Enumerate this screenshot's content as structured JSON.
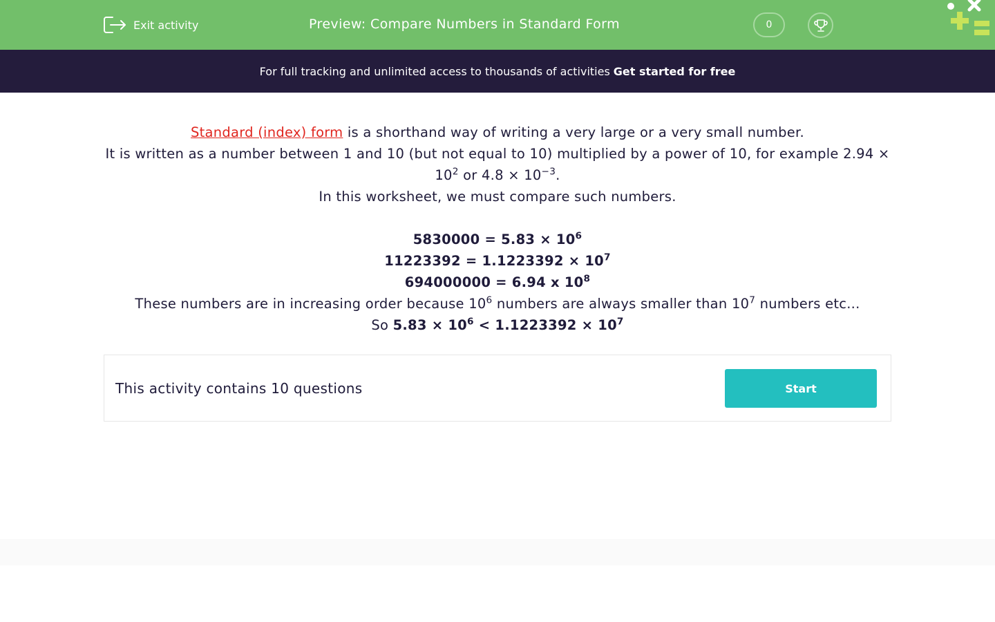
{
  "header": {
    "exit_label": "Exit activity",
    "title": "Preview: Compare Numbers in Standard Form",
    "score": "0",
    "background_color": "#72bf6a",
    "icons": [
      "exit-icon",
      "trophy-icon",
      "logo"
    ]
  },
  "promo": {
    "text": "For full tracking and unlimited access to thousands of activities",
    "cta": "Get started for free",
    "background_color": "#241c3c"
  },
  "intro": {
    "link_text": "Standard (index) form",
    "line1_rest": " is a shorthand way of writing a very large or a very small number.",
    "line2_a": "It is written as a  number between 1 and 10 (but not equal to 10) multiplied by a power of 10, for example 2.94 × 10",
    "line2_exp1": "2",
    "line2_b": " or 4.8 × 10",
    "line2_exp2": "−3",
    "line2_c": ".",
    "line3": "In this worksheet, we must compare such numbers.",
    "examples": [
      {
        "text": "5830000 = 5.83 × 10",
        "exp": "6"
      },
      {
        "text": "11223392 = 1.1223392 × 10",
        "exp": "7"
      },
      {
        "text": "694000000 = 6.94 x 10",
        "exp": "8"
      }
    ],
    "order_a": "These numbers are in increasing order because 10",
    "order_exp1": "6",
    "order_b": " numbers are always smaller than 10",
    "order_exp2": "7",
    "order_c": " numbers etc...",
    "so_prefix": "So ",
    "so_left": "5.83 × 10",
    "so_left_exp": "6",
    "so_right": " < 1.1223392 × 10",
    "so_right_exp": "7",
    "link_color": "#e0261f"
  },
  "activity": {
    "count_text": "This activity contains 10 questions",
    "start_label": "Start",
    "button_color": "#23bfbf"
  }
}
